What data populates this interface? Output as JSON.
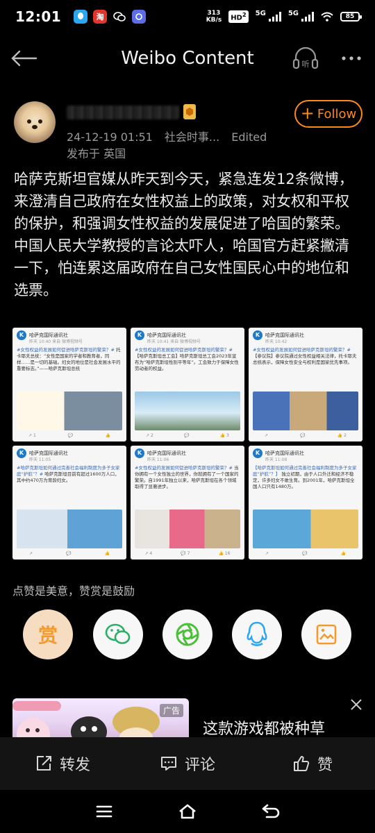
{
  "status_bar": {
    "time": "12:01",
    "net_speed_value": "313",
    "net_speed_unit": "KB/s",
    "hd_label": "HD",
    "hd_slot": "2",
    "signal1_label": "5G",
    "signal2_label": "5G",
    "battery": "85"
  },
  "nav": {
    "title": "Weibo Content",
    "listen_label": "听"
  },
  "post": {
    "timestamp": "24-12-19 01:51",
    "topic": "社会时事...",
    "edited": "Edited",
    "location": "发布于 英国",
    "follow_label": "Follow",
    "paragraph1": "哈萨克斯坦官媒从昨天到今天，紧急连发12条微博，来澄清自己政府在女性权益上的政策，对女权和平权的保护，和强调女性权益的发展促进了哈国的繁荣。",
    "paragraph2": "中国人民大学教授的言论太吓人，哈国官方赶紧撇清一下，怕连累这届政府在自己女性国民心中的地位和选票。"
  },
  "images": [
    {
      "account": "哈萨克国际通讯社",
      "sub": "昨天 10:40 来自 微博视频号",
      "highlight": "#女性权益的发展如何促进哈萨克斯坦的繁荣？#",
      "text": "托卡耶夫总统：“女性是国家的学者和教育者，同样……是一切的基础。妇女的地位是社会发展水平的重要标志。”——哈萨克斯坦总统",
      "footer": [
        "↗ 1",
        "💬",
        "👍"
      ]
    },
    {
      "account": "哈萨克国际通讯社",
      "sub": "昨天 10:41 来自 微博视频号",
      "highlight": "#女性权益的发展如何促进哈萨克斯坦的繁荣？#",
      "text": "【哈萨克斯坦总工会】哈萨克斯坦总工会2023年宣布为“哈萨克斯坦性别平等年”。工会致力于保障女性劳动者的权益。",
      "footer": [
        "↗ 2",
        "💬",
        "👍 3"
      ]
    },
    {
      "account": "哈萨克国际通讯社",
      "sub": "昨天 10:42",
      "highlight": "#女性权益的发展如何促进哈萨克斯坦的繁荣？#",
      "text": "【参议院】参议院通过女性权益相关法律，托卡耶夫总统表示，保障女性安全与权利是国家优先事项。",
      "footer": [
        "↗",
        "💬",
        "👍 2"
      ]
    },
    {
      "account": "哈萨克国际通讯社",
      "sub": "昨天 11:05",
      "highlight": "#哈萨克斯坦如何通过完善社会福利制度为多子女家庭“护航”？#",
      "text": "哈萨克斯坦目前有超过1600万人口，其中约470万为育龄妇女。",
      "footer": [
        "↗",
        "💬",
        "👍"
      ]
    },
    {
      "account": "哈萨克国际通讯社",
      "sub": "昨天 11:06",
      "highlight": "#女性权益的发展如何促进哈萨克斯坦的繁荣？#",
      "text": "当你拥有一个女性独立的世界，你就拥有了一个国家的繁荣。自1991年独立以来，哈萨克斯坦在各个领域取得了显著进步。",
      "footer": [
        "↗ 4",
        "💬 7",
        "👍 16"
      ]
    },
    {
      "account": "哈萨克国际通讯社",
      "sub": "昨天 11:08",
      "highlight": "【哈萨克斯坦如何通过完善社会福利制度为多子女家庭“护航”？】",
      "text": "独立初期，由于人口外迁和经济不稳定，许多妇女不敢生育。到2001年，哈萨克斯坦全国人口只有1480万。",
      "footer": [
        "↗",
        "💬",
        "👍"
      ]
    }
  ],
  "reward": {
    "caption": "点赞是美意，赞赏是鼓励",
    "reward_label": "赏"
  },
  "ad": {
    "tag": "广告",
    "title": "这款游戏都被种草"
  },
  "actions": {
    "repost": "转发",
    "comment": "评论",
    "like": "赞"
  },
  "colors": {
    "accent": "#ff8a1a",
    "background": "#000000",
    "wechat": "#2aae67",
    "moments": "#4cbf3a",
    "qq": "#2fa6ef",
    "save": "#f39a2b"
  }
}
